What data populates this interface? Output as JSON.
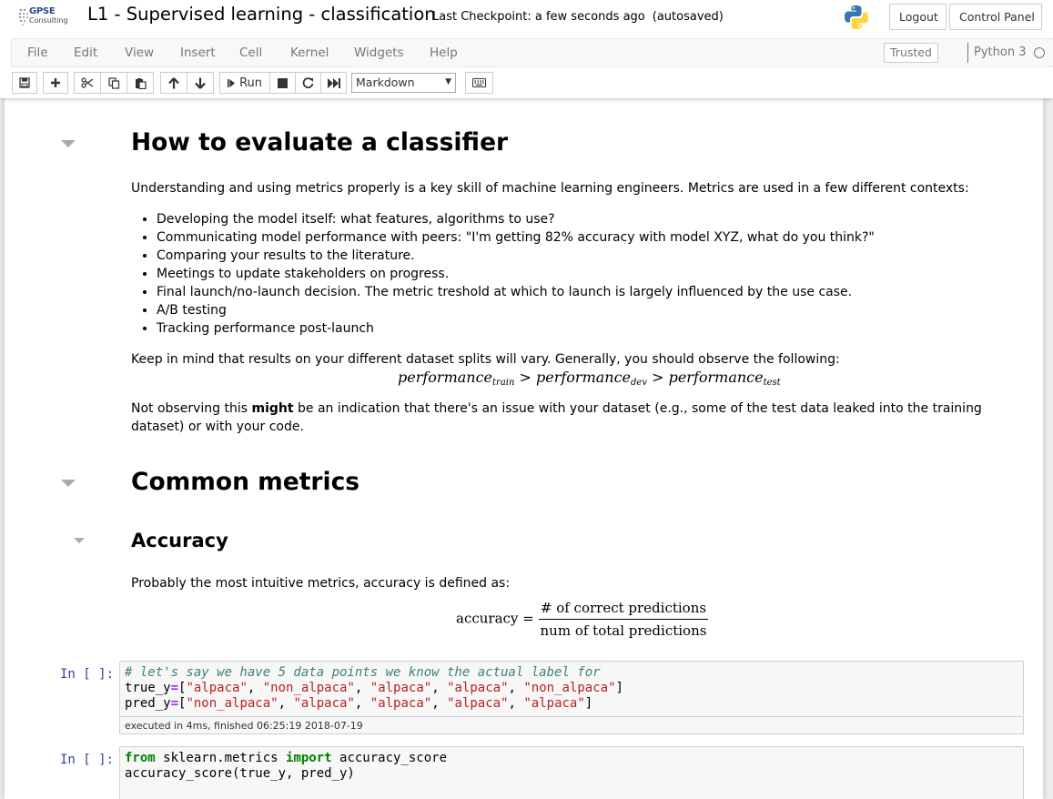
{
  "header": {
    "logo_top": "GPSE",
    "logo_bottom": "Consulting",
    "title": "L1 - Supervised learning - classification",
    "checkpoint": "Last Checkpoint: a few seconds ago",
    "autosave": "(autosaved)",
    "logout_label": "Logout",
    "control_panel_label": "Control Panel"
  },
  "menubar": {
    "items": [
      "File",
      "Edit",
      "View",
      "Insert",
      "Cell",
      "Kernel",
      "Widgets",
      "Help"
    ],
    "trusted": "Trusted",
    "kernel": "Python 3"
  },
  "toolbar": {
    "run_label": "Run",
    "cell_type": "Markdown",
    "icons": [
      "save-icon",
      "plus-icon",
      "cut-icon",
      "copy-icon",
      "paste-icon",
      "arrow-up-icon",
      "arrow-down-icon",
      "step-forward-icon",
      "stop-icon",
      "restart-icon",
      "fast-forward-icon",
      "keyboard-icon"
    ]
  },
  "notebook": {
    "h1_evaluate": "How to evaluate a classifier",
    "intro": "Understanding and using metrics properly is a key skill of machine learning engineers. Metrics are used in a few different contexts:",
    "bullets": [
      "Developing the model itself: what features, algorithms to use?",
      "Communicating model performance with peers: \"I'm getting 82% accuracy with model XYZ, what do you think?\"",
      "Comparing your results to the literature.",
      "Meetings to update stakeholders on progress.",
      "Final launch/no-launch decision. The metric treshold at which to launch is largely influenced by the use case.",
      "A/B testing",
      "Tracking performance post-launch"
    ],
    "splits_text": "Keep in mind that results on your different dataset splits will vary. Generally, you should observe the following:",
    "perf_word": "performance",
    "sub_train": "train",
    "sub_dev": "dev",
    "sub_test": "test",
    "gt": ">",
    "not_observing_pre": "Not observing this ",
    "not_observing_bold": "might",
    "not_observing_post": " be an indication that there's an issue with your dataset (e.g., some of the test data leaked into the training dataset) or with your code.",
    "h1_common": "Common metrics",
    "h2_accuracy": "Accuracy",
    "accuracy_intro": "Probably the most intuitive metrics, accuracy is defined as:",
    "acc_lhs": "accuracy =",
    "acc_num": "# of correct predictions",
    "acc_den": "num of total predictions",
    "prompt1": "In [ ]:",
    "prompt2": "In [ ]:",
    "exec_note": "executed in 4ms, finished 06:25:19 2018-07-19"
  }
}
